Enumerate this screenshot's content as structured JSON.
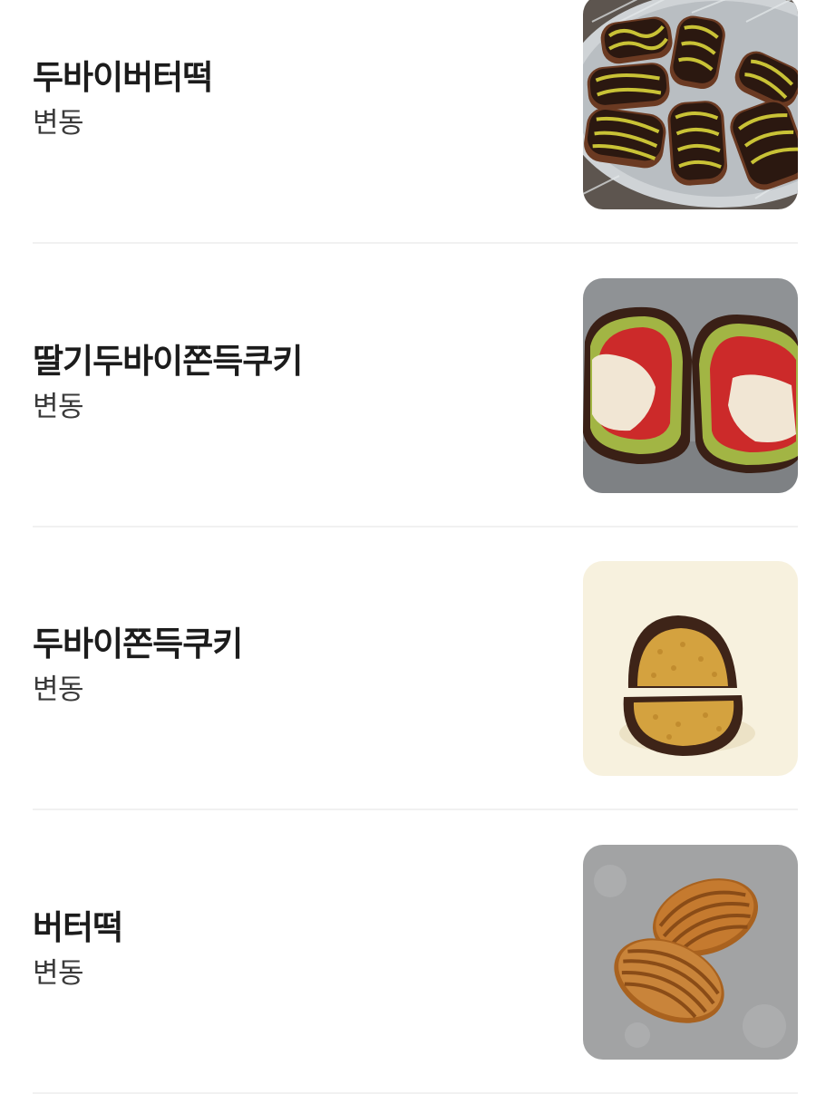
{
  "menu": {
    "items": [
      {
        "name": "두바이버터떡",
        "price": "변동",
        "thumbnail_icon": "dubai-butter-rice-cake-photo"
      },
      {
        "name": "딸기두바이쫀득쿠키",
        "price": "변동",
        "thumbnail_icon": "strawberry-dubai-chewy-cookie-photo"
      },
      {
        "name": "두바이쫀득쿠키",
        "price": "변동",
        "thumbnail_icon": "dubai-chewy-cookie-photo"
      },
      {
        "name": "버터떡",
        "price": "변동",
        "thumbnail_icon": "butter-rice-cake-photo"
      }
    ]
  },
  "colors": {
    "divider": "#f1f1f1",
    "name_text": "#1c1c1c",
    "price_text": "#3a3a3a"
  }
}
